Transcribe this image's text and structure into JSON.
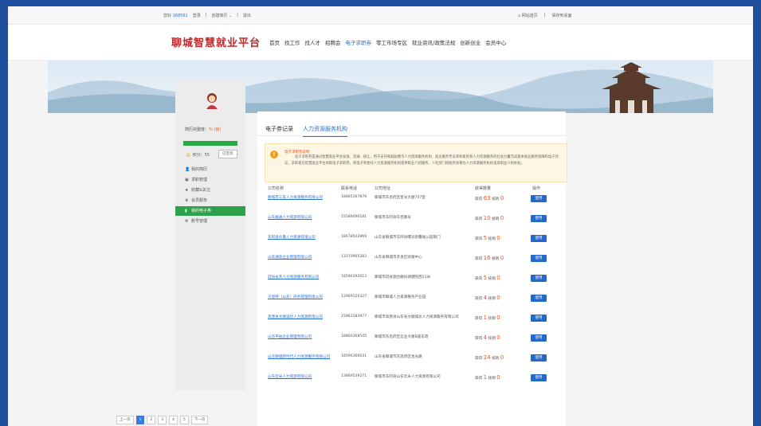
{
  "topbar": {
    "user_prefix": "您好",
    "user_id": "168561",
    "login": "登录",
    "create_resume": "创建简历 ⌄",
    "logout": "退出",
    "home": "网站首页",
    "favorite": "保存到桌面"
  },
  "header": {
    "logo": "聊城智慧就业平台",
    "nav": [
      "首页",
      "找工作",
      "找人才",
      "招聘会",
      "电子求职券",
      "零工市场专区",
      "就业资讯/政策法规",
      "创新创业",
      "会员中心"
    ],
    "nav_active_index": 4
  },
  "sidebar": {
    "completeness_label": "简历完整度：",
    "completeness_value": "% (良)",
    "completeness_percent": 100,
    "points_label": "积分：55",
    "sign_button": "已签到",
    "menu": [
      {
        "label": "我的简历",
        "icon": "person-icon"
      },
      {
        "label": "求职管理",
        "icon": "briefcase-icon"
      },
      {
        "label": "收藏&关注",
        "icon": "star-icon"
      },
      {
        "label": "会员服务",
        "icon": "crown-icon"
      },
      {
        "label": "我的电子券",
        "icon": "ticket-icon",
        "active": true
      },
      {
        "label": "账号管理",
        "icon": "gear-icon"
      }
    ]
  },
  "content": {
    "tabs": [
      "电子券记录",
      "人力资源服务机构"
    ],
    "active_tab_index": 1,
    "notice": {
      "title": "电子求职券说明",
      "body": "电子求职券是通过智慧就业平台发放、流通、核让，用于支持和鼓励我市人力资源服务机构、就业服务专员等积极的将人力资源服务的社会力量完成基本就业服务保障和电子凭证，求职者在智慧就业平台领取电子求职券，将电子券委托人力资源服务机构提供职业介绍服务，人社部门按服务效果为人力资源服务机构发放职业介绍补贴。"
    },
    "table": {
      "headers": [
        "公司名称",
        "联系电话",
        "公司地址",
        "获得数量",
        "操作"
      ],
      "get_prefix": "获得",
      "verify_prefix": "核销",
      "use_label": "使用",
      "rows": [
        {
          "name": "聊城市三友人力资源服务有限公司",
          "phone": "18865167876",
          "address": "聊城市东昌府区星光大厦707室",
          "got": "63",
          "verified": "0"
        },
        {
          "name": "山东雇通人力资源有限公司",
          "phone": "15589496181",
          "address": "聊城市东阿县东佳路号",
          "got": "10",
          "verified": "0"
        },
        {
          "name": "东阿县众鑫人力资源有限公司",
          "phone": "18678502969",
          "address": "山东省聊城市东阿县曙光街馨福公园南门",
          "got": "5",
          "verified": "0"
        },
        {
          "name": "山东通浩企业管理有限公司",
          "phone": "13370965383",
          "address": "山东省聊城市开发区财富中心",
          "got": "16",
          "verified": "0"
        },
        {
          "name": "冠县永禾人力资源服务有限公司",
          "phone": "18596392013",
          "address": "聊城市冠县烟台路妇保健院西21米",
          "got": "5",
          "verified": "0"
        },
        {
          "name": "贝恩特（山东）商务管理有限公司",
          "phone": "13969120327",
          "address": "聊城市聊城人力资源服务产业园",
          "got": "4",
          "verified": "0"
        },
        {
          "name": "高唐县文顺诚达人力资源有限公司",
          "phone": "15863183977",
          "address": "聊城市高唐县山东省文顺诚达人力资源服务有限公司",
          "got": "1",
          "verified": "0"
        },
        {
          "name": "山东平由企业管理有限公司",
          "phone": "18860368545",
          "address": "聊城市东昌府区信业大厦B座东塔",
          "got": "4",
          "verified": "0"
        },
        {
          "name": "山东聊城新时代人力资源服务有限公司",
          "phone": "18596366031",
          "address": "山东省聊城市东昌府区星光路",
          "got": "24",
          "verified": "0"
        },
        {
          "name": "山东云米人力资源有限公司",
          "phone": "13869539271",
          "address": "聊城市东阿县山东云米人力资源有限公司",
          "got": "1",
          "verified": "0"
        }
      ]
    },
    "pager": {
      "prev": "上一页",
      "pages": [
        "1",
        "2",
        "3",
        "4",
        "5"
      ],
      "active_page": "1",
      "next": "下一页"
    }
  }
}
